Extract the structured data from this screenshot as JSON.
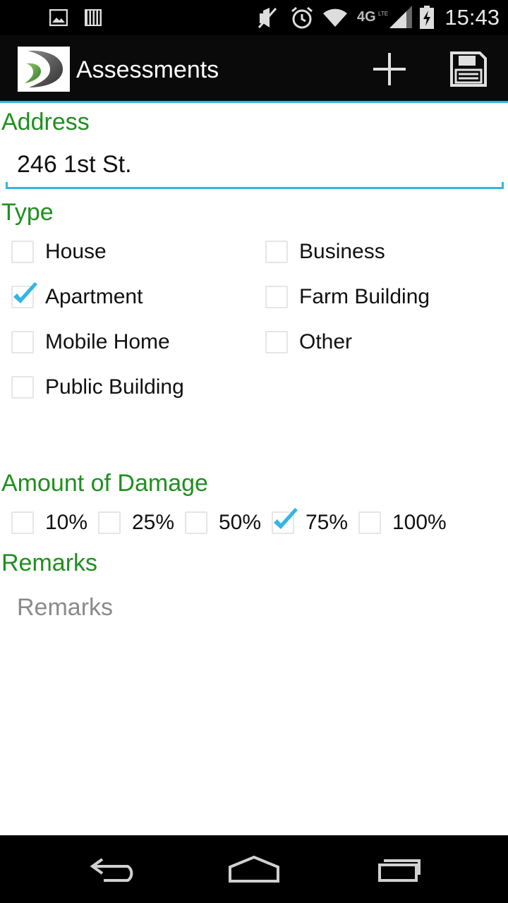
{
  "status_bar": {
    "time": "15:43",
    "icons": [
      "image-icon",
      "storage-icon",
      "mute-icon",
      "alarm-icon",
      "wifi-icon",
      "4g-lte-icon",
      "signal-icon",
      "battery-charging-icon"
    ]
  },
  "action_bar": {
    "title": "Assessments",
    "logo": "app-logo",
    "actions": [
      "add-icon",
      "save-icon"
    ]
  },
  "form": {
    "address": {
      "label": "Address",
      "value": "246 1st St."
    },
    "type": {
      "label": "Type",
      "options": [
        {
          "label": "House",
          "checked": false
        },
        {
          "label": "Business",
          "checked": false
        },
        {
          "label": "Apartment",
          "checked": true
        },
        {
          "label": "Farm Building",
          "checked": false
        },
        {
          "label": "Mobile Home",
          "checked": false
        },
        {
          "label": "Other",
          "checked": false
        },
        {
          "label": "Public Building",
          "checked": false
        }
      ]
    },
    "damage": {
      "label": "Amount of Damage",
      "options": [
        {
          "label": "10%",
          "checked": false
        },
        {
          "label": "25%",
          "checked": false
        },
        {
          "label": "50%",
          "checked": false
        },
        {
          "label": "75%",
          "checked": true
        },
        {
          "label": "100%",
          "checked": false
        }
      ]
    },
    "remarks": {
      "label": "Remarks",
      "placeholder": "Remarks"
    }
  },
  "nav_bar": {
    "buttons": [
      "back-icon",
      "home-icon",
      "recent-apps-icon"
    ]
  },
  "colors": {
    "accent": "#33b5e5",
    "label_green": "#1f8f1f",
    "check_blue": "#33b5e5"
  }
}
